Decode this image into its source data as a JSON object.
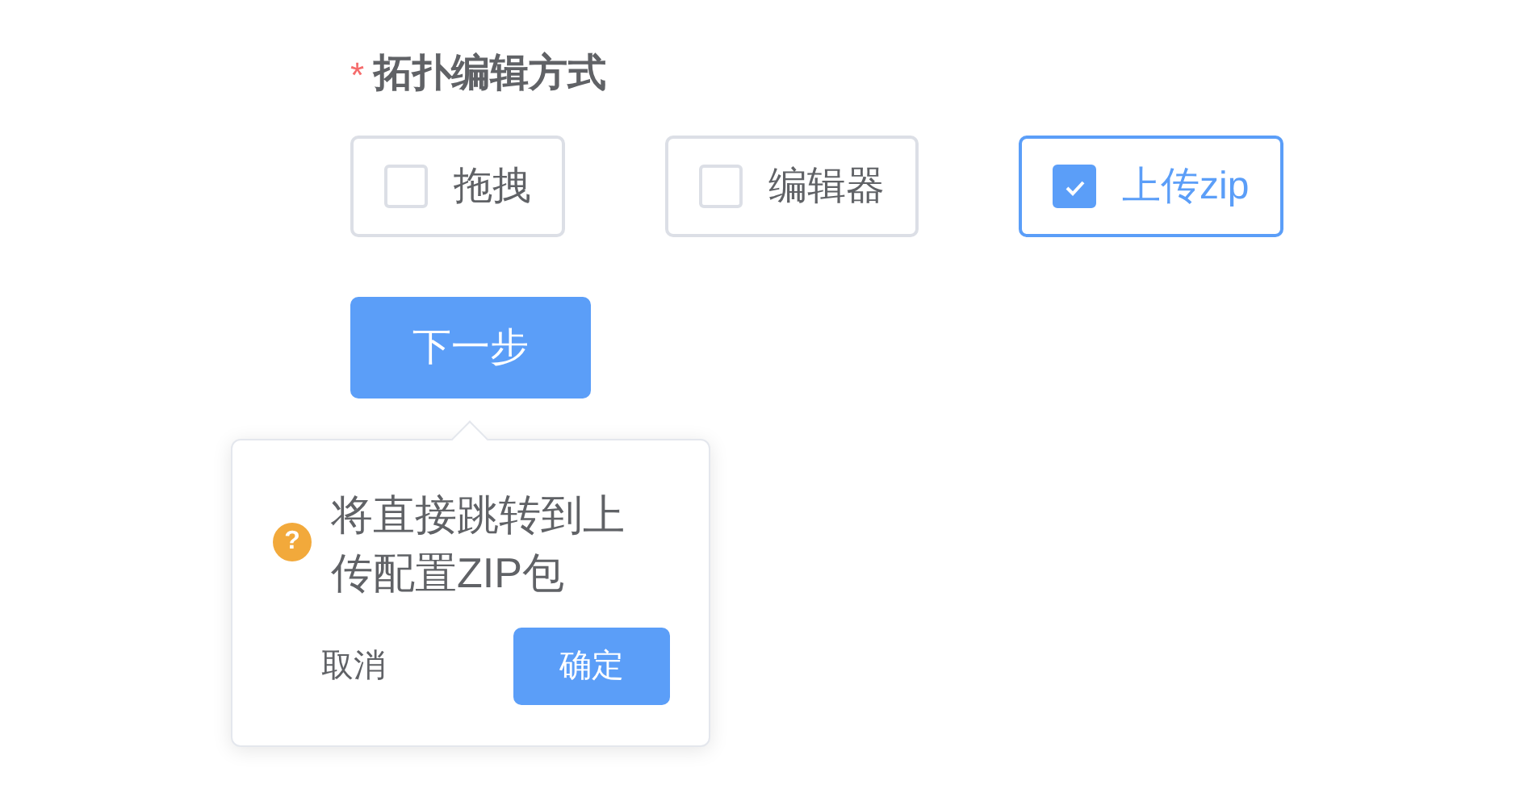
{
  "form": {
    "required_mark": "*",
    "label": "拓扑编辑方式",
    "options": [
      {
        "label": "拖拽",
        "checked": false
      },
      {
        "label": "编辑器",
        "checked": false
      },
      {
        "label": "上传zip",
        "checked": true
      }
    ]
  },
  "next_button": "下一步",
  "popconfirm": {
    "icon": "?",
    "message": "将直接跳转到上传配置ZIP包",
    "cancel": "取消",
    "confirm": "确定"
  }
}
